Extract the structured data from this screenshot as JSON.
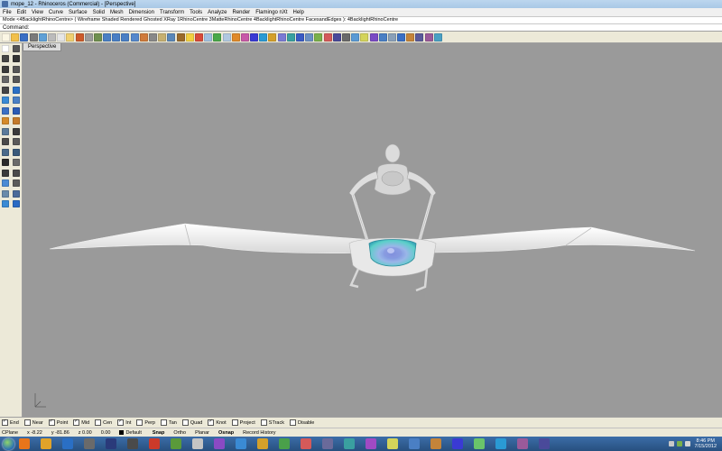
{
  "window": {
    "title": "mope_12 - Rhinoceros (Commercial) - [Perspective]"
  },
  "menu": [
    "File",
    "Edit",
    "View",
    "Curve",
    "Surface",
    "Solid",
    "Mesh",
    "Dimension",
    "Transform",
    "Tools",
    "Analyze",
    "Render",
    "Flamingo nXt",
    "Help"
  ],
  "command": {
    "history": "Mode <4BacklightRhinoCentre> ( Wireframe  Shaded  Rendered  Ghosted  XRay  1RhinoCentre  3MatteRhinoCentre  4BacklightRhinoCentre  FacesandEdges ): 4BacklightRhinoCentre",
    "label": "Command:",
    "value": ""
  },
  "toolbar_icons": [
    "new-icon",
    "open-icon",
    "save-icon",
    "print-icon",
    "import-icon",
    "cut-icon",
    "copy-icon",
    "paste-icon",
    "undo-icon",
    "pan-icon",
    "rotate-view-icon",
    "zoom-icon",
    "zoom-window-icon",
    "zoom-extents-icon",
    "zoom-selected-icon",
    "undo-view-icon",
    "grid-icon",
    "layer-icon",
    "properties-icon",
    "osnap-icon",
    "light-icon",
    "render-icon",
    "shaded-icon",
    "rendered-icon",
    "ghosted-icon",
    "material-icon",
    "texture-icon",
    "sphere-icon",
    "environment-icon",
    "flamingo-icon",
    "raytrace-icon",
    "render-window-icon",
    "options-icon",
    "help-icon",
    "analyze-icon",
    "curvature-icon",
    "zebra-icon",
    "camera-icon",
    "dimension-icon",
    "annotation-icon",
    "hatch-icon",
    "layout-icon",
    "detail-icon",
    "export-icon",
    "plugin-icon",
    "script-icon",
    "macro-icon",
    "workflow-icon"
  ],
  "toolbar_colors": [
    "#fbf6e4",
    "#f2c04a",
    "#3a6fc4",
    "#7a7a7a",
    "#5fa0d6",
    "#bbbbbb",
    "#e6e6e6",
    "#f0d070",
    "#cc5a2a",
    "#9c9c9c",
    "#6f8f4f",
    "#4a7fc4",
    "#4a7fc4",
    "#4a7fc4",
    "#5588cc",
    "#cf7a3a",
    "#888888",
    "#c6b070",
    "#5a87b8",
    "#9a6a2a",
    "#f2d040",
    "#d84a3a",
    "#a0c0e0",
    "#4aa84a",
    "#b0c8e0",
    "#e08a2a",
    "#c85aa8",
    "#3a3ad4",
    "#2a9ad4",
    "#d4a02a",
    "#7a7ad4",
    "#3aa0a0",
    "#3a5ac4",
    "#6a8fc4",
    "#7ab04a",
    "#d45a5a",
    "#4a4a9a",
    "#6a6a6a",
    "#5a9ad4",
    "#d4d45a",
    "#7a4ac4",
    "#4a7fc4",
    "#8aa0b8",
    "#3a6fc4",
    "#c4843a",
    "#5a5a9a",
    "#9a5a9a",
    "#4aa0c4"
  ],
  "sidebar_icons": [
    "select-icon",
    "point-icon",
    "polyline-icon",
    "curve-icon",
    "circle-icon",
    "arc-icon",
    "ellipse-icon",
    "rectangle-icon",
    "polygon-icon",
    "freeform-icon",
    "surface-icon",
    "extrude-icon",
    "box-icon",
    "sphere-icon",
    "boolean-icon",
    "fillet-icon",
    "transform-icon",
    "move-icon",
    "array-icon",
    "mirror-icon",
    "scale-icon",
    "rotate-icon",
    "join-icon",
    "explode-icon",
    "trim-icon",
    "split-icon",
    "dimension-icon",
    "text-icon",
    "block-icon",
    "group-icon",
    "analyze-icon",
    "render-icon"
  ],
  "sidebar_colors": [
    "#ffffff",
    "#555555",
    "#444444",
    "#333333",
    "#3a3a3a",
    "#555555",
    "#666666",
    "#555555",
    "#444444",
    "#2a6fc4",
    "#3a8ad4",
    "#4a7fc4",
    "#3a6fc4",
    "#2a5ab4",
    "#d48a2a",
    "#c47a2a",
    "#5a7a9a",
    "#3a3a3a",
    "#4a4a4a",
    "#5a5a5a",
    "#4a6a8a",
    "#3a5a7a",
    "#2a2a2a",
    "#6a6a6a",
    "#3a3a3a",
    "#4a4a4a",
    "#4a8ad4",
    "#5a5a5a",
    "#6a8aaa",
    "#4a6a9a",
    "#3a8ad4",
    "#2a6ac4"
  ],
  "viewport": {
    "label": "Perspective",
    "background": "#9a9a9a"
  },
  "osnaps": [
    {
      "label": "End",
      "checked": true
    },
    {
      "label": "Near",
      "checked": false
    },
    {
      "label": "Point",
      "checked": true
    },
    {
      "label": "Mid",
      "checked": true
    },
    {
      "label": "Cen",
      "checked": false
    },
    {
      "label": "Int",
      "checked": true
    },
    {
      "label": "Perp",
      "checked": false
    },
    {
      "label": "Tan",
      "checked": false
    },
    {
      "label": "Quad",
      "checked": false
    },
    {
      "label": "Knot",
      "checked": true
    },
    {
      "label": "Project",
      "checked": false
    },
    {
      "label": "STrack",
      "checked": false
    },
    {
      "label": "Disable",
      "checked": false
    }
  ],
  "status": {
    "cplane": "CPlane",
    "x": "x -8.22",
    "y": "y -81.86",
    "z": "z 0.00",
    "distance": "0.00",
    "layer": "Default",
    "panes": [
      {
        "label": "Snap",
        "bold": true
      },
      {
        "label": "Ortho",
        "bold": false
      },
      {
        "label": "Planar",
        "bold": false
      },
      {
        "label": "Osnap",
        "bold": true
      },
      {
        "label": "Record History",
        "bold": false
      }
    ]
  },
  "taskbar": {
    "apps": [
      "firefox-icon",
      "explorer-icon",
      "media-player-icon",
      "zbrush-icon",
      "photoshop-icon",
      "rhino-icon",
      "app-icon",
      "app-icon",
      "app-icon",
      "app-icon",
      "app-icon",
      "app-icon",
      "app-icon",
      "app-icon",
      "app-icon",
      "app-icon",
      "app-icon",
      "app-icon",
      "app-icon",
      "app-icon",
      "app-icon",
      "app-icon",
      "app-icon",
      "app-icon",
      "app-icon"
    ],
    "app_colors": [
      "#e8751a",
      "#e0a32a",
      "#2a6fc4",
      "#6a6a6a",
      "#2a3a7a",
      "#4a4a4a",
      "#cc3a2a",
      "#5a9a3a",
      "#c4c4c4",
      "#8a4ac4",
      "#3a8ad4",
      "#d4a02a",
      "#4aa04a",
      "#d45a5a",
      "#6a6a9a",
      "#3aa0a0",
      "#a04ac4",
      "#d4d45a",
      "#4a7fc4",
      "#c4843a",
      "#3a3ad4",
      "#6ac46a",
      "#2a9ad4",
      "#9a5a9a",
      "#4a4a9a"
    ],
    "clock_time": "8:46 PM",
    "clock_date": "7/15/2012"
  }
}
